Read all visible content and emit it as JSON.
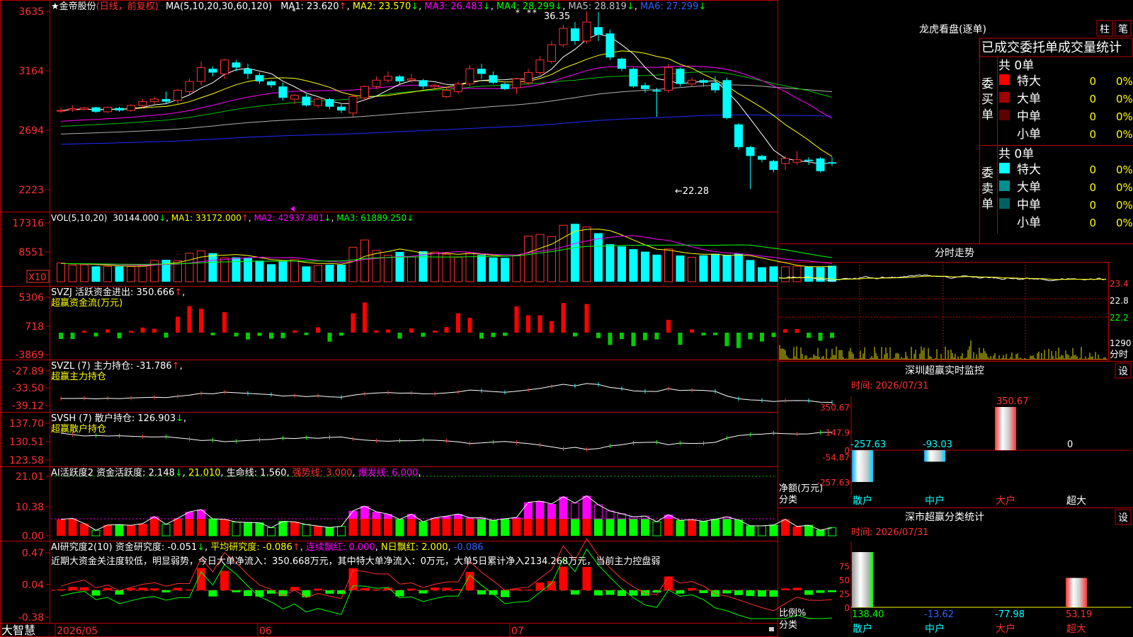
{
  "app": {
    "brand": "大智慧"
  },
  "main_header": {
    "star": "★",
    "stock_name": "金帝股份",
    "period": "(日线，前复权)",
    "ma_label": "MA(5,10,20,30,60,120)",
    "ma": [
      {
        "label": "MA1: 23.620",
        "arrow": "↑",
        "color": "#ffffff"
      },
      {
        "label": "MA2: 23.570",
        "arrow": "↓",
        "color": "#ffff00"
      },
      {
        "label": "MA3: 26.483",
        "arrow": "↓",
        "color": "#ff00ff"
      },
      {
        "label": "MA4: 28.299",
        "arrow": "↓",
        "color": "#00ff00"
      },
      {
        "label": "MA5: 28.819",
        "arrow": "↓",
        "color": "#c0c0c0"
      },
      {
        "label": "MA6: 27.299",
        "arrow": "↓",
        "color": "#3030ff"
      }
    ],
    "high_label": "36.35",
    "low_label": "←22.28"
  },
  "price_axis": [
    "3635",
    "3164",
    "2694",
    "2223"
  ],
  "vol_header": {
    "name": "VOL(5,10,20)",
    "value": "30144.000",
    "ma": [
      {
        "label": "MA1: 33172.000",
        "arrow": "↑",
        "color": "#ffff00"
      },
      {
        "label": "MA2: 42937.801",
        "arrow": "↓",
        "color": "#ff00ff"
      },
      {
        "label": "MA3: 61889.250",
        "arrow": "↓",
        "color": "#00ff00"
      }
    ]
  },
  "vol_axis": [
    "17316",
    "8551"
  ],
  "vol_unit": "X10",
  "svzj": {
    "line1": "SVZJ  活跃资金进出: 350.666",
    "arrow": "↑",
    "trail": ",",
    "line2": "超赢资金流(万元)",
    "axis": [
      "5306",
      "718",
      "-3869"
    ]
  },
  "svzl": {
    "line1": "SVZL (7) 主力持仓: -31.786",
    "arrow": "↑",
    "trail": ",",
    "line2": "超赢主力持仓",
    "axis": [
      "-27.89",
      "-33.50",
      "-39.12"
    ]
  },
  "svsh": {
    "line1": "SVSH (7) 散户持仓: 126.903",
    "arrow": "↓",
    "trail": ",",
    "line2": "超赢散户持仓",
    "axis": [
      "137.70",
      "130.51",
      "123.58"
    ]
  },
  "ai1": {
    "name": "AI活跃度2 资金活跃度: 2.148",
    "arrow": "↓",
    "v2": "21.010",
    "v3": "生命线: 1.560",
    "v4": "强势线: 3.000",
    "v5": "爆发线: 6.000",
    "axis": [
      "21.01",
      "10.38",
      "0.00"
    ]
  },
  "ai2": {
    "name": "AI研究度2(10) 资金研究度: -0.051",
    "v2": "平均研究度: -0.086",
    "v3": "连续飘红: 0.000",
    "v4": "N日飘红: 2.000",
    "v5": "-0.086",
    "comment": "近期大资金关注度较低，明显弱势，今日大单净流入：350.668万元，其中特大单净流入：0万元，大单5日累计净入2134.268万元，当前主力控盘弱",
    "axis": [
      "0.47",
      "0.04",
      "-0.38"
    ]
  },
  "x_axis": [
    "2026/05",
    "06",
    "07"
  ],
  "lhb": {
    "title": "龙虎看盘(逐单)",
    "btn1": "柱",
    "btn2": "笔",
    "subtitle": "已成交委托单成交量统计",
    "buy_label": "委买单",
    "sell_label": "委卖单",
    "total_buy": "共 0单",
    "total_sell": "共 0单",
    "buy_rows": [
      {
        "name": "特大",
        "val": "0",
        "pct": "0%",
        "color": "#ff0000"
      },
      {
        "name": "大单",
        "val": "0",
        "pct": "0%",
        "color": "#a00000"
      },
      {
        "name": "中单",
        "val": "0",
        "pct": "0%",
        "color": "#600000"
      },
      {
        "name": "小单",
        "val": "0",
        "pct": "0%",
        "color": ""
      }
    ],
    "sell_rows": [
      {
        "name": "特大",
        "val": "0",
        "pct": "0%",
        "color": "#00ffff"
      },
      {
        "name": "大单",
        "val": "0",
        "pct": "0%",
        "color": "#009090"
      },
      {
        "name": "中单",
        "val": "0",
        "pct": "0%",
        "color": "#006060"
      },
      {
        "name": "小单",
        "val": "0",
        "pct": "0%",
        "color": ""
      }
    ]
  },
  "intraday": {
    "title": "分时走势",
    "axis": [
      "23.4",
      "22.8",
      "22.2"
    ],
    "vol_label": "1290",
    "tag": "分时"
  },
  "monitor": {
    "title": "深圳超赢实时监控",
    "btn": "设",
    "time": "时间: 2026/07/31",
    "axis": [
      "350.67",
      "147.9",
      "0",
      "-54.87",
      "-257.63"
    ],
    "unit": "净额(万元)",
    "cat_label": "分类",
    "values": [
      {
        "cat": "散户",
        "value": -257.63,
        "label": "-257.63"
      },
      {
        "cat": "中户",
        "value": -93.03,
        "label": "-93.03"
      },
      {
        "cat": "大户",
        "value": 350.67,
        "label": "350.67"
      },
      {
        "cat": "超大",
        "value": 0,
        "label": "0"
      }
    ]
  },
  "classify": {
    "title": "深市超赢分类统计",
    "btn": "设",
    "time": "时间: 2026/07/31",
    "axis": [
      "75",
      "50",
      "25",
      "0"
    ],
    "unit": "比例%",
    "cat_label": "分类",
    "values": [
      {
        "cat": "散户",
        "value": 138.4,
        "label": "138.40"
      },
      {
        "cat": "中户",
        "value": -13.62,
        "label": "-13.62"
      },
      {
        "cat": "大户",
        "value": -77.98,
        "label": "-77.98"
      },
      {
        "cat": "超大",
        "value": 53.19,
        "label": "53.19"
      }
    ]
  },
  "chart_data": {
    "type": "candlestick",
    "title": "金帝股份",
    "ylim": [
      22.23,
      36.35
    ],
    "candles": [
      [
        28.45,
        28.5,
        28.3,
        28.7
      ],
      [
        28.55,
        28.65,
        28.4,
        28.9
      ],
      [
        28.6,
        28.7,
        28.5,
        28.8
      ],
      [
        28.75,
        28.4,
        28.3,
        28.8
      ],
      [
        28.4,
        28.75,
        28.3,
        28.8
      ],
      [
        28.7,
        28.5,
        28.4,
        28.8
      ],
      [
        28.5,
        28.9,
        28.4,
        29.0
      ],
      [
        28.9,
        29.2,
        28.7,
        29.4
      ],
      [
        29.2,
        29.4,
        29.0,
        29.6
      ],
      [
        29.4,
        29.2,
        29.0,
        30.0
      ],
      [
        29.3,
        30.1,
        29.0,
        30.2
      ],
      [
        30.0,
        30.8,
        29.8,
        31.0
      ],
      [
        30.8,
        31.9,
        30.5,
        32.4
      ],
      [
        31.8,
        31.5,
        31.2,
        32.0
      ],
      [
        31.4,
        32.5,
        31.0,
        32.6
      ],
      [
        32.3,
        31.9,
        31.6,
        32.5
      ],
      [
        31.8,
        31.4,
        31.0,
        32.2
      ],
      [
        31.3,
        30.8,
        30.6,
        31.5
      ],
      [
        30.8,
        30.5,
        30.3,
        30.9
      ],
      [
        30.4,
        29.5,
        29.3,
        30.7
      ],
      [
        29.4,
        29.7,
        29.0,
        29.8
      ],
      [
        29.6,
        28.9,
        28.8,
        29.8
      ],
      [
        28.9,
        29.4,
        28.7,
        29.5
      ],
      [
        29.4,
        28.8,
        28.6,
        29.5
      ],
      [
        28.8,
        28.5,
        28.3,
        29.0
      ],
      [
        28.3,
        29.6,
        28.0,
        29.8
      ],
      [
        29.5,
        30.4,
        29.3,
        30.5
      ],
      [
        30.4,
        30.9,
        30.2,
        31.2
      ],
      [
        30.9,
        31.2,
        30.7,
        31.6
      ],
      [
        31.2,
        30.8,
        30.6,
        31.3
      ],
      [
        30.9,
        31.0,
        30.7,
        31.4
      ],
      [
        30.9,
        30.4,
        30.2,
        31.0
      ],
      [
        30.4,
        30.5,
        30.2,
        30.6
      ],
      [
        29.6,
        30.1,
        29.5,
        30.3
      ],
      [
        30.0,
        30.6,
        29.8,
        30.8
      ],
      [
        30.6,
        31.8,
        30.4,
        32.1
      ],
      [
        31.8,
        31.4,
        31.0,
        32.2
      ],
      [
        31.3,
        30.7,
        30.6,
        31.6
      ],
      [
        30.6,
        30.2,
        30.1,
        30.7
      ],
      [
        30.3,
        31.0,
        29.8,
        31.1
      ],
      [
        30.7,
        31.5,
        30.5,
        31.8
      ],
      [
        31.5,
        32.5,
        31.3,
        32.8
      ],
      [
        32.4,
        33.7,
        32.2,
        34.0
      ],
      [
        33.7,
        35.0,
        33.5,
        35.3
      ],
      [
        35.0,
        34.0,
        33.7,
        35.5
      ],
      [
        34.0,
        35.5,
        33.8,
        36.35
      ],
      [
        35.1,
        34.5,
        34.0,
        36.3
      ],
      [
        34.6,
        32.7,
        32.5,
        34.9
      ],
      [
        32.6,
        31.8,
        31.6,
        32.7
      ],
      [
        31.8,
        30.4,
        30.3,
        31.9
      ],
      [
        30.5,
        30.2,
        29.9,
        30.7
      ],
      [
        30.1,
        30.0,
        28.0,
        30.3
      ],
      [
        30.1,
        31.9,
        29.9,
        32.2
      ],
      [
        31.8,
        30.6,
        30.4,
        31.9
      ],
      [
        30.6,
        30.9,
        30.4,
        31.1
      ],
      [
        30.9,
        30.7,
        30.4,
        31.0
      ],
      [
        30.7,
        30.1,
        29.9,
        31.2
      ],
      [
        30.9,
        27.9,
        27.8,
        31.1
      ],
      [
        27.4,
        25.6,
        25.4,
        27.5
      ],
      [
        25.6,
        24.9,
        22.28,
        25.7
      ],
      [
        24.9,
        24.6,
        24.4,
        25.0
      ],
      [
        24.5,
        23.8,
        23.6,
        24.6
      ],
      [
        24.3,
        24.7,
        23.8,
        24.9
      ],
      [
        24.4,
        24.6,
        24.2,
        25.3
      ],
      [
        24.6,
        24.5,
        24.2,
        24.8
      ],
      [
        24.7,
        23.7,
        23.6,
        24.8
      ],
      [
        24.4,
        24.3,
        24.1,
        24.8
      ]
    ],
    "volume": [
      8.8,
      7.8,
      7.9,
      7.2,
      7.2,
      7.2,
      7.1,
      7.6,
      10.0,
      10.3,
      9.8,
      13.4,
      14.5,
      13.4,
      11.2,
      11.4,
      11.1,
      9.9,
      8.2,
      9.5,
      10.4,
      7.2,
      7.6,
      8.0,
      8.0,
      16.2,
      19.6,
      14.7,
      12.4,
      14.0,
      11.7,
      14.3,
      13.9,
      12.9,
      11.5,
      13.8,
      12.5,
      11.4,
      11.2,
      12.2,
      21.4,
      22.2,
      21.2,
      26.5,
      27.2,
      25.7,
      22.8,
      17.6,
      16.6,
      15.3,
      14.1,
      12.7,
      15.4,
      12.3,
      11.5,
      12.4,
      13.1,
      12.5,
      13.2,
      10.2,
      6.8,
      7.2,
      7.0,
      7.3,
      7.0,
      6.8,
      7.5
    ]
  }
}
